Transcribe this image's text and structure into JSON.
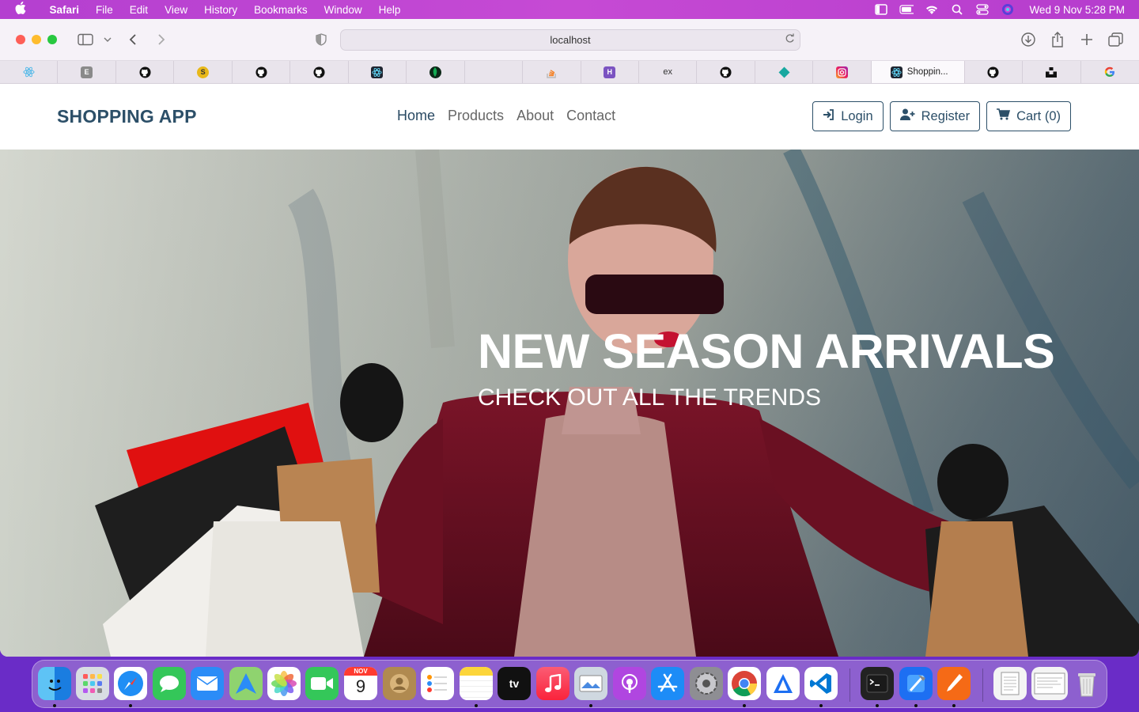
{
  "menubar": {
    "app_name": "Safari",
    "menus": [
      "File",
      "Edit",
      "View",
      "History",
      "Bookmarks",
      "Window",
      "Help"
    ],
    "clock": "Wed 9 Nov  5:28 PM"
  },
  "browser": {
    "url": "localhost",
    "active_tab_title": "Shoppin..."
  },
  "tab_icons": [
    "react-icon",
    "e-icon",
    "github-icon",
    "coin-icon",
    "github-icon",
    "github-icon",
    "react-icon",
    "leaf-icon",
    "blank-tab",
    "stackoverflow-icon",
    "heroku-icon",
    "express-icon",
    "github-icon",
    "diamond-icon",
    "instagram-icon",
    "react-icon",
    "github-icon",
    "unsplash-icon",
    "google-icon"
  ],
  "express_label": "ex",
  "app": {
    "brand": "SHOPPING APP",
    "nav": {
      "home": "Home",
      "products": "Products",
      "about": "About",
      "contact": "Contact"
    },
    "actions": {
      "login": "Login",
      "register": "Register",
      "cart": "Cart (0)"
    },
    "hero": {
      "title": "NEW SEASON ARRIVALS",
      "subtitle": "CHECK OUT ALL THE TRENDS"
    }
  },
  "calendar": {
    "month": "NOV",
    "day": "9"
  },
  "appletv_label": "tv",
  "colors": {
    "brand": "#2c4f68",
    "menubar": "#c64ad4",
    "dock_bg": "#6a2cc7"
  }
}
